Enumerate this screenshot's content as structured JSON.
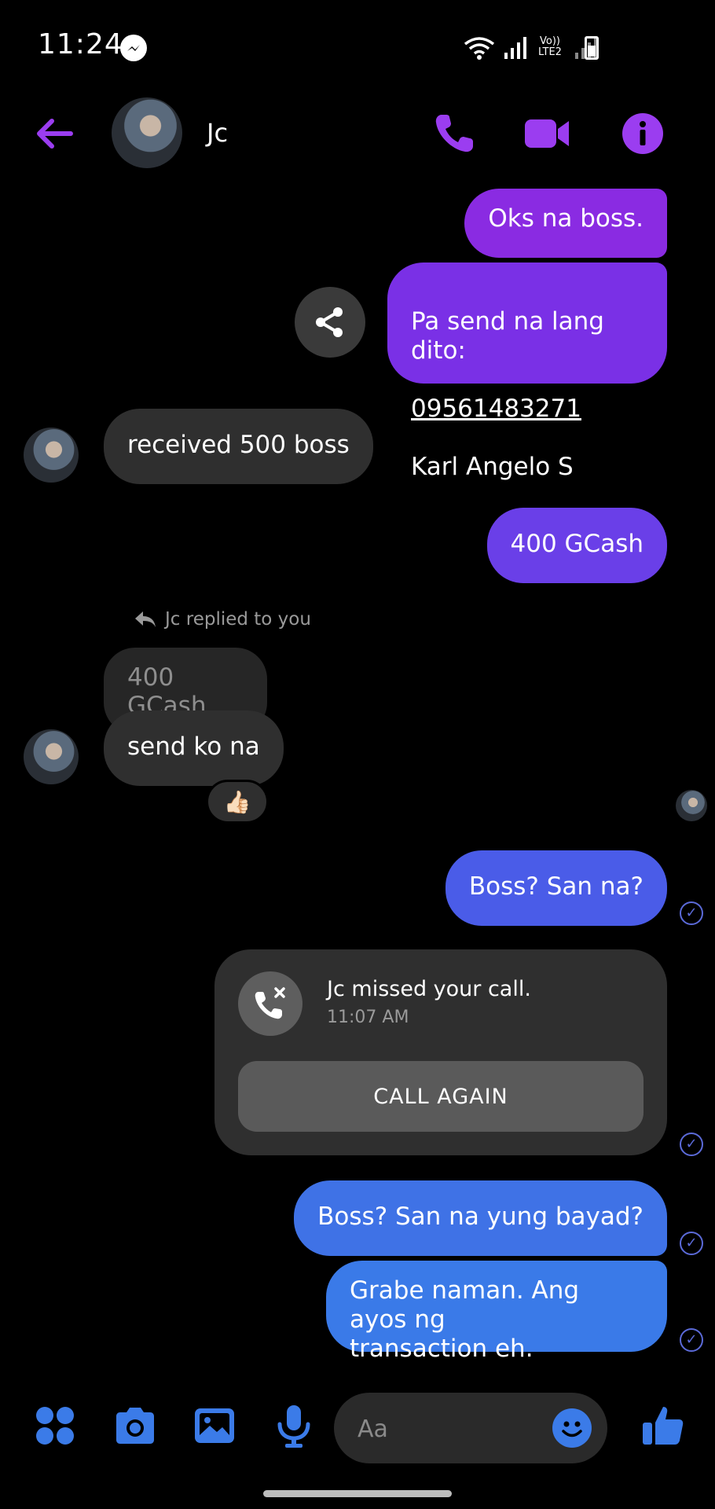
{
  "status_bar": {
    "time": "11:24",
    "network_label": "Vo)) LTE2"
  },
  "header": {
    "contact_name": "Jc"
  },
  "messages": {
    "m1": "Oks na boss.",
    "m2": "Pa send na lang dito:",
    "m2_number": "09561483271",
    "m2_name": "Karl Angelo S",
    "m3": "received 500 boss",
    "m4": "400 GCash",
    "reply_label": "Jc replied to you",
    "quoted_text": "400 GCash",
    "m5": "send ko na",
    "reaction_emoji": "👍🏻",
    "m6": "Boss? San na?",
    "m7": "Boss? San na yung bayad?",
    "m8": "Grabe naman. Ang ayos ng\ntransaction eh."
  },
  "missed_call": {
    "title": "Jc missed your call.",
    "time": "11:07 AM",
    "button": "CALL AGAIN"
  },
  "composer": {
    "placeholder": "Aa"
  },
  "colors": {
    "accent_purple": "#9b3df0",
    "accent_blue": "#3b7be8",
    "seen": "#5b6ad8"
  }
}
